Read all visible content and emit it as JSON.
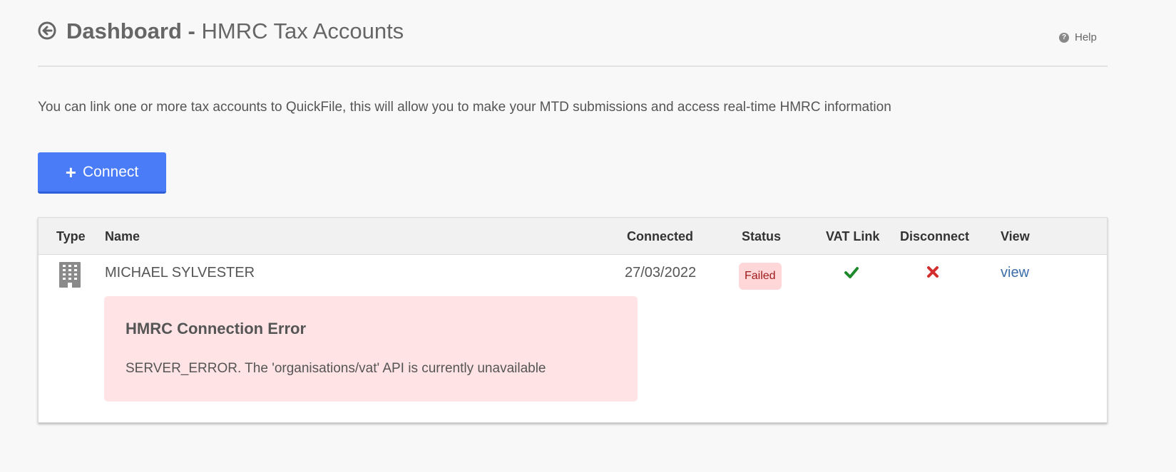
{
  "header": {
    "title_strong": "Dashboard",
    "title_separator": " - ",
    "title_rest": "HMRC Tax Accounts",
    "help_label": "Help"
  },
  "intro_text": "You can link one or more tax accounts to QuickFile, this will allow you to make your MTD submissions and access real-time HMRC information",
  "connect_label": "Connect",
  "table": {
    "columns": [
      "Type",
      "Name",
      "Connected",
      "Status",
      "VAT Link",
      "Disconnect",
      "View"
    ],
    "rows": [
      {
        "type_icon": "building-icon",
        "name": "MICHAEL SYLVESTER",
        "connected": "27/03/2022",
        "status": "Failed",
        "vat_link_icon": "check-icon",
        "disconnect_icon": "cross-icon",
        "view": "view",
        "error": {
          "title": "HMRC Connection Error",
          "message": "SERVER_ERROR. The 'organisations/vat' API is currently unavailable"
        }
      }
    ]
  },
  "colors": {
    "primary_button": "#4a7cf7",
    "status_failed_bg": "#ffd7d9",
    "status_failed_text": "#9e1a1a",
    "check_green": "#1f8a2c",
    "cross_red": "#d32f2f",
    "link_blue": "#3b6ea8",
    "error_bg": "#ffe3e5"
  }
}
